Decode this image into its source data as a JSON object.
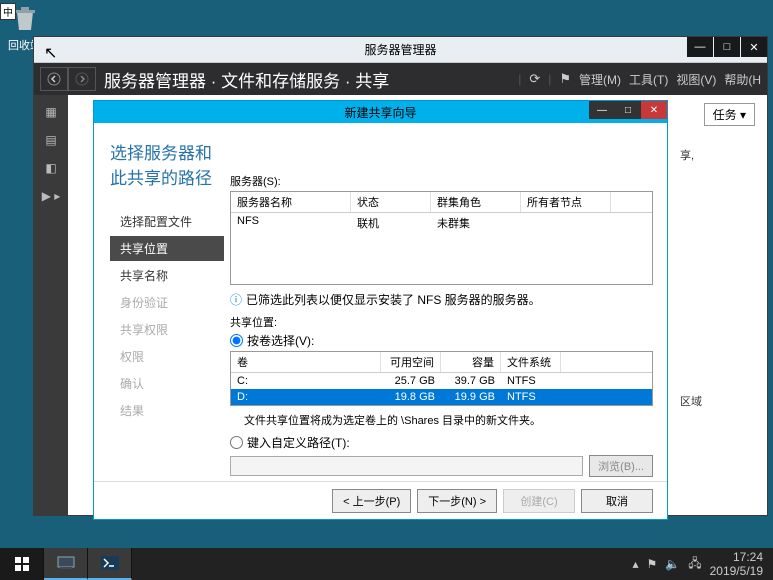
{
  "desktop": {
    "recycle_bin": "回收站",
    "ime": "中"
  },
  "srvmgr": {
    "title": "服务器管理器",
    "breadcrumb": "服务器管理器 · 文件和存储服务 · 共享",
    "menus": {
      "manage": "管理(M)",
      "tools": "工具(T)",
      "view": "视图(V)",
      "help": "帮助(H"
    },
    "tasks": "任务  ▾",
    "body_hint1": "享,",
    "body_hint2": "区域"
  },
  "wizard": {
    "title": "新建共享向导",
    "heading": "选择服务器和此共享的路径",
    "steps": {
      "profile": "选择配置文件",
      "location": "共享位置",
      "name": "共享名称",
      "auth": "身份验证",
      "perm": "共享权限",
      "permissions": "权限",
      "confirm": "确认",
      "results": "结果"
    },
    "server_label": "服务器(S):",
    "server_cols": {
      "name": "服务器名称",
      "state": "状态",
      "role": "群集角色",
      "owner": "所有者节点"
    },
    "server_row": {
      "name": "NFS",
      "state": "联机",
      "role": "未群集",
      "owner": ""
    },
    "info": "已筛选此列表以便仅显示安装了 NFS 服务器的服务器。",
    "share_loc_label": "共享位置:",
    "vol_select": "按卷选择(V):",
    "vol_cols": {
      "vol": "卷",
      "free": "可用空间",
      "cap": "容量",
      "fs": "文件系统"
    },
    "vols": [
      {
        "vol": "C:",
        "free": "25.7 GB",
        "cap": "39.7 GB",
        "fs": "NTFS"
      },
      {
        "vol": "D:",
        "free": "19.8 GB",
        "cap": "19.9 GB",
        "fs": "NTFS"
      }
    ],
    "vol_note": "文件共享位置将成为选定卷上的 \\Shares 目录中的新文件夹。",
    "custom_path": "键入自定义路径(T):",
    "browse": "浏览(B)...",
    "btns": {
      "prev": "< 上一步(P)",
      "next": "下一步(N) >",
      "create": "创建(C)",
      "cancel": "取消"
    }
  },
  "taskbar": {
    "time": "17:24",
    "date": "2019/5/19"
  }
}
